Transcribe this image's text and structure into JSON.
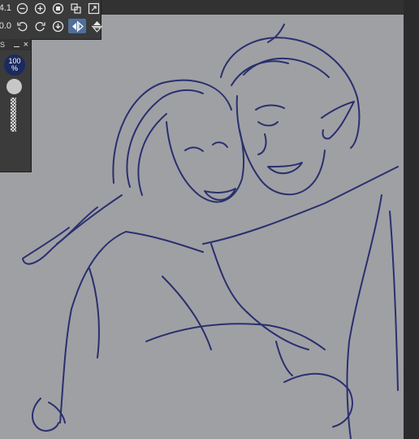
{
  "toolbar": {
    "zoom_value": "4.1",
    "rotation_value": "0.0",
    "row1_icons": [
      "zoom-out-icon",
      "zoom-in-icon",
      "stop-icon",
      "fit-window-icon",
      "fullscreen-icon"
    ],
    "row2_icons": [
      "rotate-left-icon",
      "rotate-right-icon",
      "reset-rotation-icon",
      "flip-horizontal-icon",
      "flip-vertical-icon"
    ],
    "active_tool": "flip-horizontal-icon"
  },
  "brush_panel": {
    "tab_label": "S",
    "opacity": "100",
    "opacity_unit": "%",
    "close_label": "×"
  },
  "canvas": {
    "background_color": "#9fa0a4",
    "line_color": "#2a2f6e"
  }
}
